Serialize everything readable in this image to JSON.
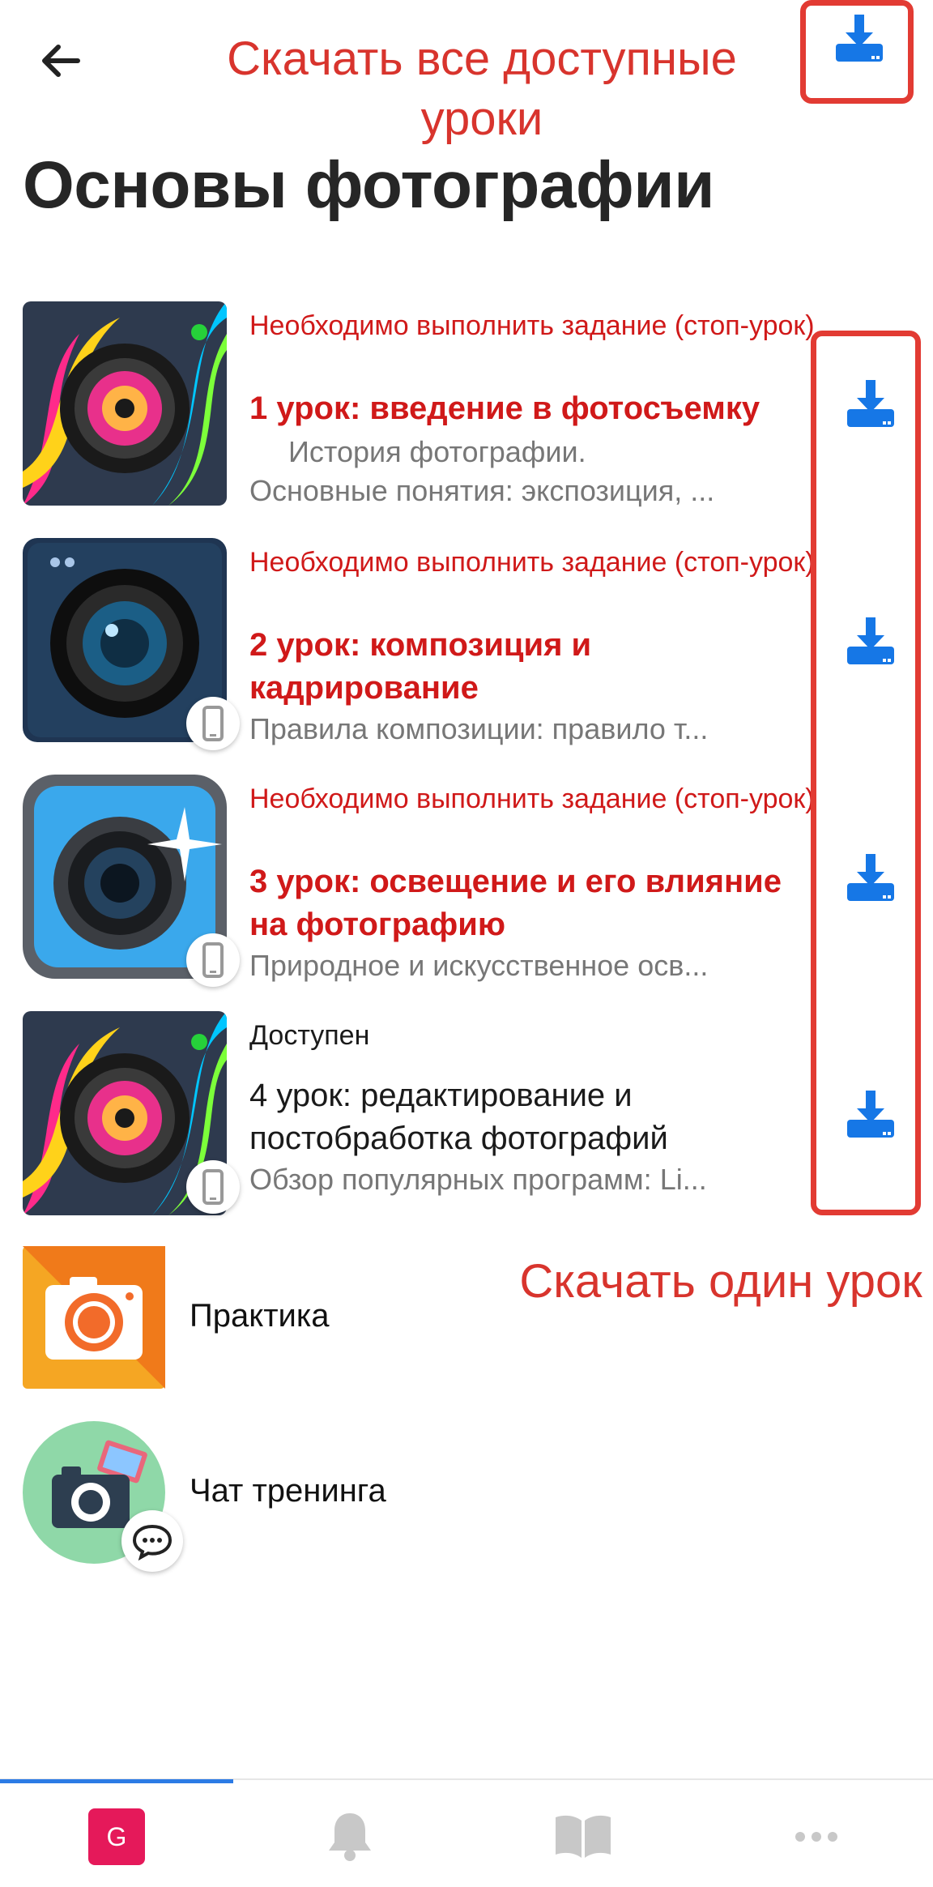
{
  "annotations": {
    "download_all": "Скачать все доступные уроки",
    "download_one": "Скачать один урок"
  },
  "page": {
    "title": "Основы фотографии"
  },
  "lessons": [
    {
      "status": "Необходимо выполнить задание (стоп-урок)",
      "title": "1 урок: введение в фотосъемку",
      "desc_line1": "История фотографии.",
      "desc_line2": "Основные понятия: экспозиция, ..."
    },
    {
      "status": "Необходимо выполнить задание (стоп-урок)",
      "title": "2 урок: композиция и кадрирование",
      "desc": "Правила композиции: правило т..."
    },
    {
      "status": "Необходимо выполнить задание (стоп-урок)",
      "title": "3 урок: освещение и его влияние на фотографию",
      "desc": "Природное и искусственное осв..."
    },
    {
      "status": "Доступен",
      "title": "4 урок: редактирование и постобработка фотографий",
      "desc": "Обзор популярных программ: Li..."
    }
  ],
  "extras": [
    {
      "label": "Практика"
    },
    {
      "label": "Чат тренинга"
    }
  ],
  "nav": {
    "avatar_letter": "G"
  },
  "colors": {
    "accent": "#1677e6",
    "locked": "#d01919",
    "annotation": "#d8342d"
  }
}
